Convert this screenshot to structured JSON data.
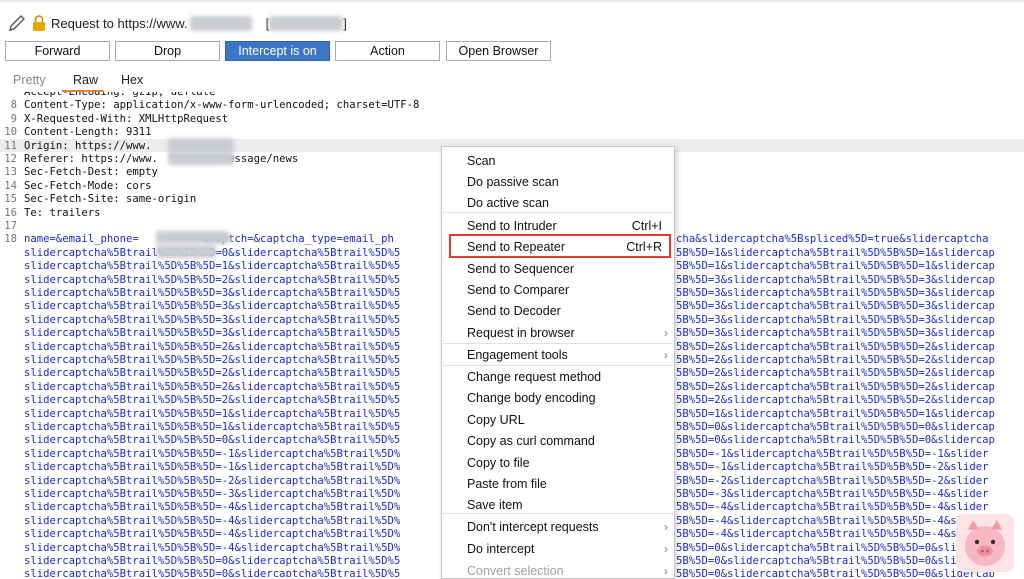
{
  "header": {
    "request_label": "Request to https://www.",
    "bracket_open": "[",
    "bracket_close": "]"
  },
  "toolbar": {
    "forward": "Forward",
    "drop": "Drop",
    "intercept": "Intercept is on",
    "action": "Action",
    "open_browser": "Open Browser"
  },
  "tabs": {
    "pretty": "Pretty",
    "raw": "Raw",
    "hex": "Hex"
  },
  "editor": {
    "lines": [
      {
        "n": "",
        "t": "Accept-Encoding: gzip, deflate"
      },
      {
        "n": "8",
        "t": "Content-Type: application/x-www-form-urlencoded; charset=UTF-8"
      },
      {
        "n": "9",
        "t": "X-Requested-With: XMLHttpRequest"
      },
      {
        "n": "10",
        "t": "Content-Length: 9311"
      },
      {
        "n": "11",
        "t": "Origin: https://www."
      },
      {
        "n": "12",
        "t": "Referer: https://www.         /message/news"
      },
      {
        "n": "13",
        "t": "Sec-Fetch-Dest: empty"
      },
      {
        "n": "14",
        "t": "Sec-Fetch-Mode: cors"
      },
      {
        "n": "15",
        "t": "Sec-Fetch-Site: same-origin"
      },
      {
        "n": "16",
        "t": "Te: trailers"
      },
      {
        "n": "17",
        "t": ""
      },
      {
        "n": "18",
        "t": "name=&email_phone=          &captch=&captcha_type=email_ph"
      }
    ],
    "body_right": "cha&slidercaptcha%5Bspliced%5D=true&slidercaptcha",
    "body_rows": [
      [
        "slidercaptcha%5Btrail%5D%5B%5D=0&slidercaptcha%5Btrail%5D%5",
        "5B%5D=1&slidercaptcha%5Btrail%5D%5B%5D=1&slidercap"
      ],
      [
        "slidercaptcha%5Btrail%5D%5B%5D=1&slidercaptcha%5Btrail%5D%5",
        "5B%5D=1&slidercaptcha%5Btrail%5D%5B%5D=1&slidercap"
      ],
      [
        "slidercaptcha%5Btrail%5D%5B%5D=2&slidercaptcha%5Btrail%5D%5",
        "5B%5D=3&slidercaptcha%5Btrail%5D%5B%5D=3&slidercap"
      ],
      [
        "slidercaptcha%5Btrail%5D%5B%5D=3&slidercaptcha%5Btrail%5D%5",
        "5B%5D=3&slidercaptcha%5Btrail%5D%5B%5D=3&slidercap"
      ],
      [
        "slidercaptcha%5Btrail%5D%5B%5D=3&slidercaptcha%5Btrail%5D%5",
        "5B%5D=3&slidercaptcha%5Btrail%5D%5B%5D=3&slidercap"
      ],
      [
        "slidercaptcha%5Btrail%5D%5B%5D=3&slidercaptcha%5Btrail%5D%5",
        "5B%5D=3&slidercaptcha%5Btrail%5D%5B%5D=3&slidercap"
      ],
      [
        "slidercaptcha%5Btrail%5D%5B%5D=3&slidercaptcha%5Btrail%5D%5",
        "5B%5D=3&slidercaptcha%5Btrail%5D%5B%5D=3&slidercap"
      ],
      [
        "slidercaptcha%5Btrail%5D%5B%5D=2&slidercaptcha%5Btrail%5D%5",
        "5B%5D=2&slidercaptcha%5Btrail%5D%5B%5D=2&slidercap"
      ],
      [
        "slidercaptcha%5Btrail%5D%5B%5D=2&slidercaptcha%5Btrail%5D%5",
        "5B%5D=2&slidercaptcha%5Btrail%5D%5B%5D=2&slidercap"
      ],
      [
        "slidercaptcha%5Btrail%5D%5B%5D=2&slidercaptcha%5Btrail%5D%5",
        "5B%5D=2&slidercaptcha%5Btrail%5D%5B%5D=2&slidercap"
      ],
      [
        "slidercaptcha%5Btrail%5D%5B%5D=2&slidercaptcha%5Btrail%5D%5",
        "5B%5D=2&slidercaptcha%5Btrail%5D%5B%5D=2&slidercap"
      ],
      [
        "slidercaptcha%5Btrail%5D%5B%5D=2&slidercaptcha%5Btrail%5D%5",
        "5B%5D=2&slidercaptcha%5Btrail%5D%5B%5D=2&slidercap"
      ],
      [
        "slidercaptcha%5Btrail%5D%5B%5D=1&slidercaptcha%5Btrail%5D%5",
        "5B%5D=1&slidercaptcha%5Btrail%5D%5B%5D=1&slidercap"
      ],
      [
        "slidercaptcha%5Btrail%5D%5B%5D=1&slidercaptcha%5Btrail%5D%5",
        "5B%5D=0&slidercaptcha%5Btrail%5D%5B%5D=0&slidercap"
      ],
      [
        "slidercaptcha%5Btrail%5D%5B%5D=0&slidercaptcha%5Btrail%5D%5",
        "5B%5D=0&slidercaptcha%5Btrail%5D%5B%5D=0&slidercap"
      ],
      [
        "slidercaptcha%5Btrail%5D%5B%5D=-1&slidercaptcha%5Btrail%5D%",
        "5B%5D=-1&slidercaptcha%5Btrail%5D%5B%5D=-1&slider"
      ],
      [
        "slidercaptcha%5Btrail%5D%5B%5D=-1&slidercaptcha%5Btrail%5D%",
        "5B%5D=-1&slidercaptcha%5Btrail%5D%5B%5D=-2&slider"
      ],
      [
        "slidercaptcha%5Btrail%5D%5B%5D=-2&slidercaptcha%5Btrail%5D%",
        "5B%5D=-2&slidercaptcha%5Btrail%5D%5B%5D=-2&slider"
      ],
      [
        "slidercaptcha%5Btrail%5D%5B%5D=-3&slidercaptcha%5Btrail%5D%",
        "5B%5D=-3&slidercaptcha%5Btrail%5D%5B%5D=-4&slider"
      ],
      [
        "slidercaptcha%5Btrail%5D%5B%5D=-4&slidercaptcha%5Btrail%5D%",
        "5B%5D=-4&slidercaptcha%5Btrail%5D%5B%5D=-4&slider"
      ],
      [
        "slidercaptcha%5Btrail%5D%5B%5D=-4&slidercaptcha%5Btrail%5D%",
        "5B%5D=-4&slidercaptcha%5Btrail%5D%5B%5D=-4&slider"
      ],
      [
        "slidercaptcha%5Btrail%5D%5B%5D=-4&slidercaptcha%5Btrail%5D%",
        "5B%5D=-4&slidercaptcha%5Btrail%5D%5B%5D=-4&slider"
      ],
      [
        "slidercaptcha%5Btrail%5D%5B%5D=-4&slidercaptcha%5Btrail%5D%",
        "5B%5D=0&slidercaptcha%5Btrail%5D%5B%5D=0&slidercap"
      ],
      [
        "slidercaptcha%5Btrail%5D%5B%5D=0&slidercaptcha%5Btrail%5D%5",
        "5B%5D=0&slidercaptcha%5Btrail%5D%5B%5D=0&slidercap"
      ],
      [
        "slidercaptcha%5Btrail%5D%5B%5D=0&slidercaptcha%5Btrail%5D%5",
        "5B%5D=0&slidercaptcha%5Btrail%5D%5B%5D=0&slidercap"
      ],
      [
        "slidercaptcha%5Btrail%5D%5B%5D=0&slidercaptcha%5Btrail%5D%5",
        "5B%5D=0&slidercaptcha%5Btrail%5D%5B%5D=0&slidercap"
      ]
    ]
  },
  "context_menu": {
    "items": [
      {
        "label": "Scan",
        "shortcut": "",
        "arrow": false
      },
      {
        "label": "Do passive scan",
        "shortcut": "",
        "arrow": false
      },
      {
        "label": "Do active scan",
        "shortcut": "",
        "arrow": false
      },
      {
        "label": "Send to Intruder",
        "shortcut": "Ctrl+I",
        "arrow": false
      },
      {
        "label": "Send to Repeater",
        "shortcut": "Ctrl+R",
        "arrow": false
      },
      {
        "label": "Send to Sequencer",
        "shortcut": "",
        "arrow": false
      },
      {
        "label": "Send to Comparer",
        "shortcut": "",
        "arrow": false
      },
      {
        "label": "Send to Decoder",
        "shortcut": "",
        "arrow": false
      },
      {
        "label": "Request in browser",
        "shortcut": "",
        "arrow": true
      },
      {
        "label": "Engagement tools",
        "shortcut": "",
        "arrow": true
      },
      {
        "label": "Change request method",
        "shortcut": "",
        "arrow": false
      },
      {
        "label": "Change body encoding",
        "shortcut": "",
        "arrow": false
      },
      {
        "label": "Copy URL",
        "shortcut": "",
        "arrow": false
      },
      {
        "label": "Copy as curl command",
        "shortcut": "",
        "arrow": false
      },
      {
        "label": "Copy to file",
        "shortcut": "",
        "arrow": false
      },
      {
        "label": "Paste from file",
        "shortcut": "",
        "arrow": false
      },
      {
        "label": "Save item",
        "shortcut": "",
        "arrow": false
      },
      {
        "label": "Don't intercept requests",
        "shortcut": "",
        "arrow": true
      },
      {
        "label": "Do intercept",
        "shortcut": "",
        "arrow": true
      },
      {
        "label": "Convert selection",
        "shortcut": "",
        "arrow": true,
        "disabled": true
      }
    ]
  },
  "colors": {
    "accent_button": "#3c76c4",
    "highlight_border": "#e23a32",
    "tab_underline": "#ef7f34",
    "body_text": "#1c2bd0"
  }
}
